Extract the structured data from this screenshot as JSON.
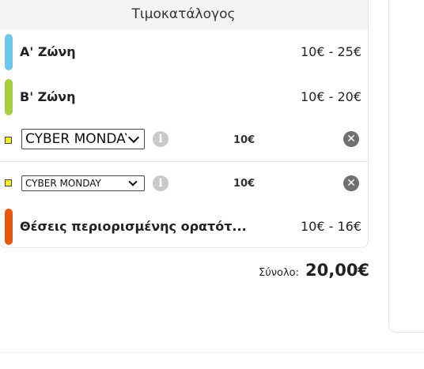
{
  "price_list": {
    "title": "Τιμοκατάλογος",
    "zones": [
      {
        "name": "Α' Ζώνη",
        "price": "10€ - 25€",
        "color": "#6ec6ea"
      },
      {
        "name": "Β' Ζώνη",
        "price": "10€ - 20€",
        "color": "#a6cc3f"
      },
      {
        "name": "Θέσεις περιορισμένης ορατότ...",
        "price": "10€ - 16€",
        "color": "#e4590f"
      }
    ],
    "offers": [
      {
        "selected_option": "CYBER MONDAY",
        "price": "10€",
        "swatch_color": "#f3ee27"
      },
      {
        "selected_option": "CYBER MONDAY",
        "price": "10€",
        "swatch_color": "#f3ee27"
      }
    ],
    "icons": {
      "info": "info-icon",
      "remove": "close-circle-icon",
      "dropdown": "chevron-down-icon"
    }
  },
  "summary": {
    "total_label": "Σύνολο:",
    "total_value": "20,00€"
  }
}
